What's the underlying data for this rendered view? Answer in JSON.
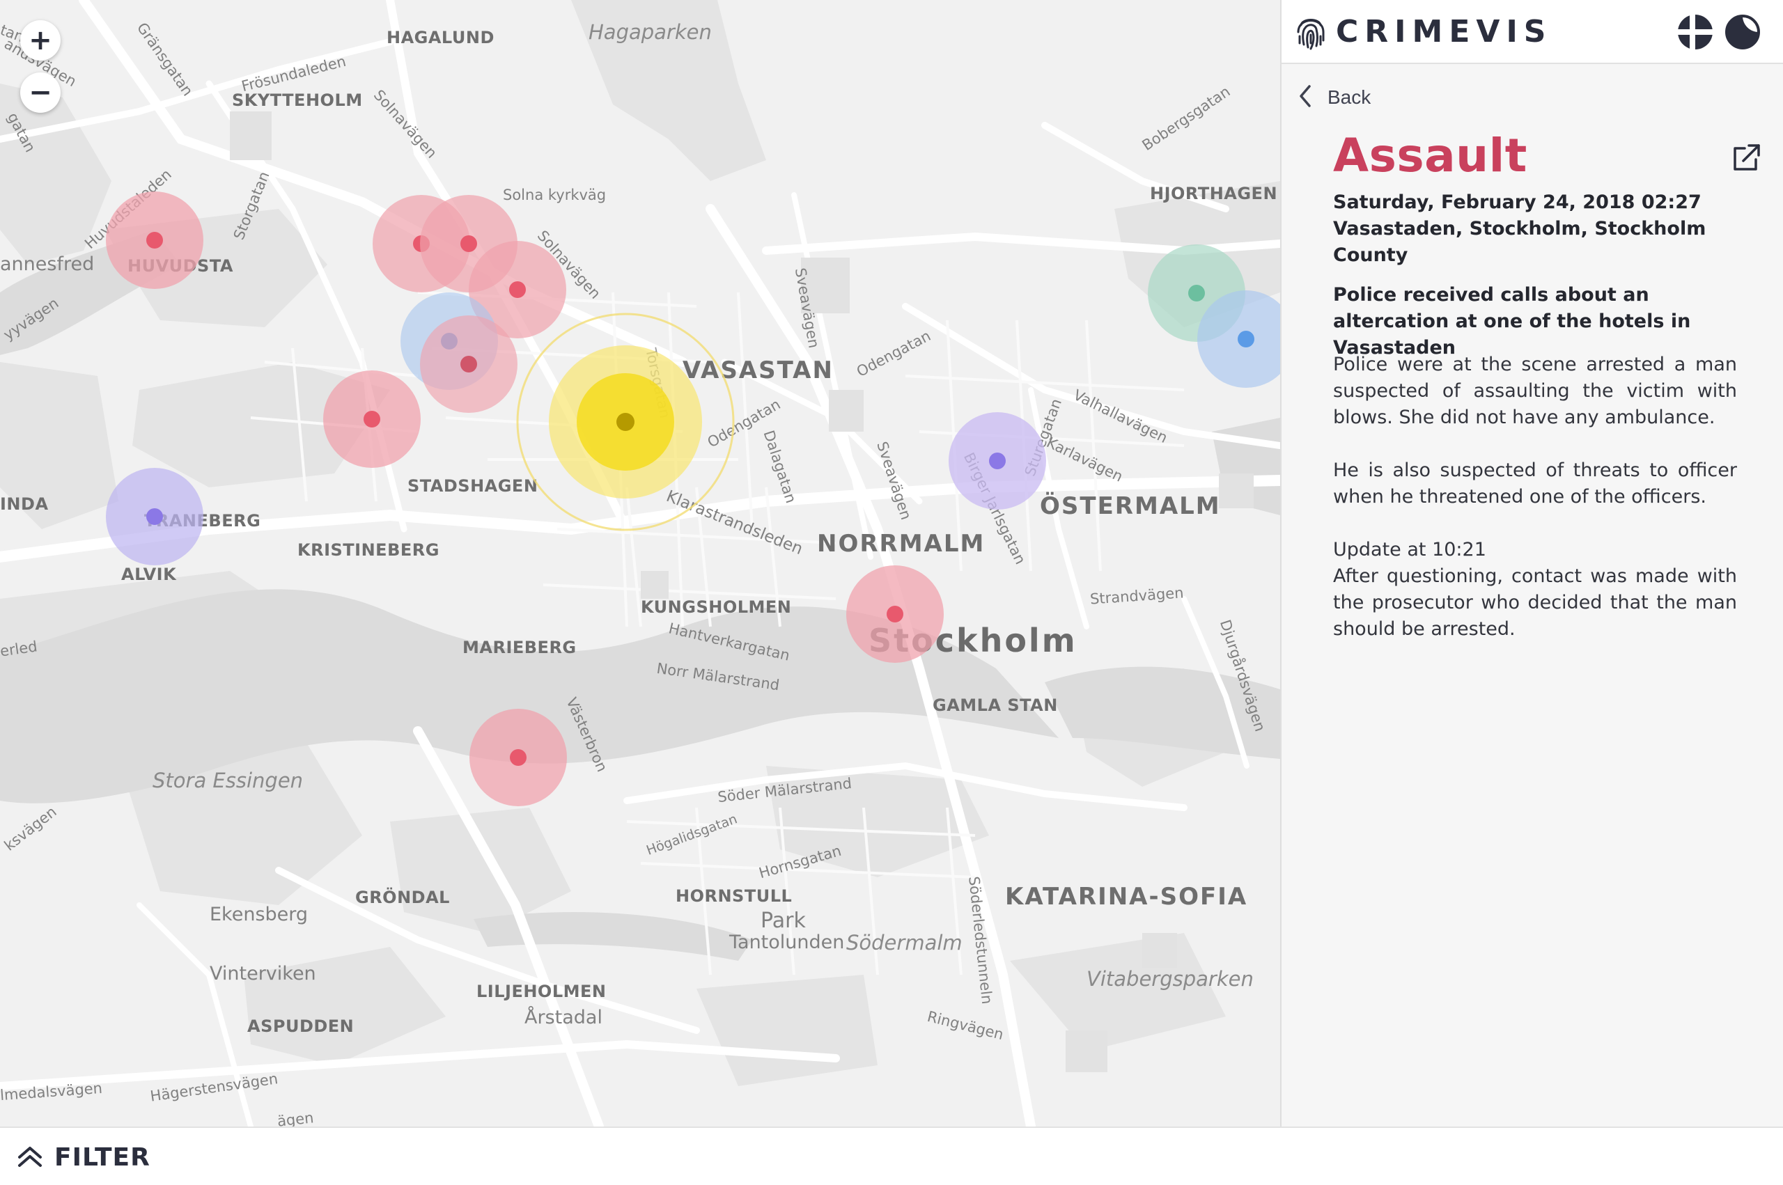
{
  "map": {
    "zoom_in_label": "+",
    "zoom_out_label": "−",
    "labels": {
      "hagalund": "HAGALUND",
      "hagaparken": "Hagaparken",
      "skytteholm": "SKYTTEHOLM",
      "frosundaleden": "Frösundaleden",
      "solnavagen": "Solnavägen",
      "gransgatan": "Gränsgatan",
      "huvudstaleden": "Huvudstaleden",
      "storgatan": "Storgatan",
      "solna_kyrkvag": "Solna kyrkväg",
      "solnavagen2": "Solnavägen",
      "huvudsta": "HUVUDSTA",
      "annesfred": "annesfred",
      "vasastan": "VASASTAN",
      "sveavagen_n": "Sveavägen",
      "odengatan_n": "Odengatan",
      "odengatan": "Odengatan",
      "torsgatan": "Torsgatan",
      "dalagatan": "Dalagatan",
      "sveavagen": "Sveavägen",
      "bobergsgatan": "Bobergsgatan",
      "hjorthagen": "HJORTHAGEN",
      "valhallavagen": "Valhallavägen",
      "sturegatan": "Sturegatan",
      "karlavagen": "Karlavägen",
      "birger_jarlsgatan": "Birger Jarlsgatan",
      "ostermalm": "ÖSTERMALM",
      "stadshagen": "STADSHAGEN",
      "traneberg": "TRANEBERG",
      "inda": "INDA",
      "alvik": "ALVIK",
      "kristineberg": "KRISTINEBERG",
      "klarastrandsleden": "Klarastrandsleden",
      "norrmalm": "NORRMALM",
      "kungsholmen": "KUNGSHOLMEN",
      "hantverkargatan": "Hantverkargatan",
      "norr_malarstrand": "Norr Mälarstrand",
      "marieberg": "MARIEBERG",
      "stockholm": "Stockholm",
      "strandvagen": "Strandvägen",
      "djurgardsvagen": "Djurgårdsvägen",
      "gamla_stan": "GAMLA STAN",
      "vasterbron": "Västerbron",
      "stora_essingen": "Stora Essingen",
      "soder_malarstrand": "Söder Mälarstrand",
      "hogalidsgatan": "Högalidsgatan",
      "hornsgatan": "Hornsgatan",
      "hornstull": "HORNSTULL",
      "katarina_sofia": "KATARINA-SOFIA",
      "soderledstunneln": "Söderledstunneln",
      "grondal": "GRÖNDAL",
      "ekensberg": "Ekensberg",
      "park": "Park",
      "tantolunden": "Tantolunden",
      "sodermalm": "Södermalm",
      "vitabergsparken": "Vitabergsparken",
      "vinterviken": "Vinterviken",
      "liljeholmen": "LILJEHOLMEN",
      "arstadal": "Årstadal",
      "aspudden": "ASPUDDEN",
      "ringvagen": "Ringvägen",
      "hagerstensvagen": "Hägerstensvägen",
      "almedalsvagen": "lmedalsvägen",
      "ksvagen": "ksvägen",
      "yvagen": "yyvägen",
      "erled": "erled",
      "gatan_left": "gatan",
      "landsvagen": "andsvägen",
      "tan": "tan",
      "agen_bottom": "ägen"
    },
    "incidents": [
      {
        "name": "incident-huvudsta",
        "category": "assault",
        "selected": false
      },
      {
        "name": "incident-solna-1",
        "category": "assault",
        "selected": false
      },
      {
        "name": "incident-solna-2",
        "category": "assault",
        "selected": false
      },
      {
        "name": "incident-solna-3",
        "category": "assault",
        "selected": false
      },
      {
        "name": "incident-solna-blue",
        "category": "other",
        "selected": false
      },
      {
        "name": "incident-solna-4",
        "category": "assault",
        "selected": false
      },
      {
        "name": "incident-stadshagen",
        "category": "assault",
        "selected": false
      },
      {
        "name": "incident-vasastaden-selected",
        "category": "assault",
        "selected": true
      },
      {
        "name": "incident-traneberg",
        "category": "other",
        "selected": false
      },
      {
        "name": "incident-ostermalm",
        "category": "other",
        "selected": false
      },
      {
        "name": "incident-hjorthagen-green",
        "category": "other",
        "selected": false
      },
      {
        "name": "incident-hjorthagen-blue",
        "category": "other",
        "selected": false
      },
      {
        "name": "incident-norrmalm",
        "category": "assault",
        "selected": false
      },
      {
        "name": "incident-vasterbron",
        "category": "assault",
        "selected": false
      }
    ],
    "colors": {
      "assault": "#e8596d",
      "selected": "#f5dc1e",
      "purple": "#8b78e6",
      "blue": "#5b9be6",
      "green": "#6cbf9f"
    }
  },
  "header": {
    "title": "CRIMEVIS",
    "logo_icon": "fingerprint-icon",
    "language_icon": "nordic-flag-icon",
    "theme_icon": "moon-icon"
  },
  "detail": {
    "back_label": "Back",
    "type": "Assault",
    "datetime": "Saturday, February 24, 2018 02:27",
    "location": "Vasastaden, Stockholm, Stockholm County",
    "summary": "Police received calls about an altercation at one of the hotels in Vasastaden",
    "paragraph1": "Police were at the scene arrested a man suspected of assaulting the victim with blows. She did not have any ambulance.",
    "paragraph2": "He is also suspected of threats to officer when he threatened one of the officers.",
    "update_title": "Update at 10:21",
    "update_text": "After questioning, contact was made with the prosecutor who decided that the man should be arrested.",
    "accent_color": "#c9415d"
  },
  "filter": {
    "label": "FILTER"
  }
}
